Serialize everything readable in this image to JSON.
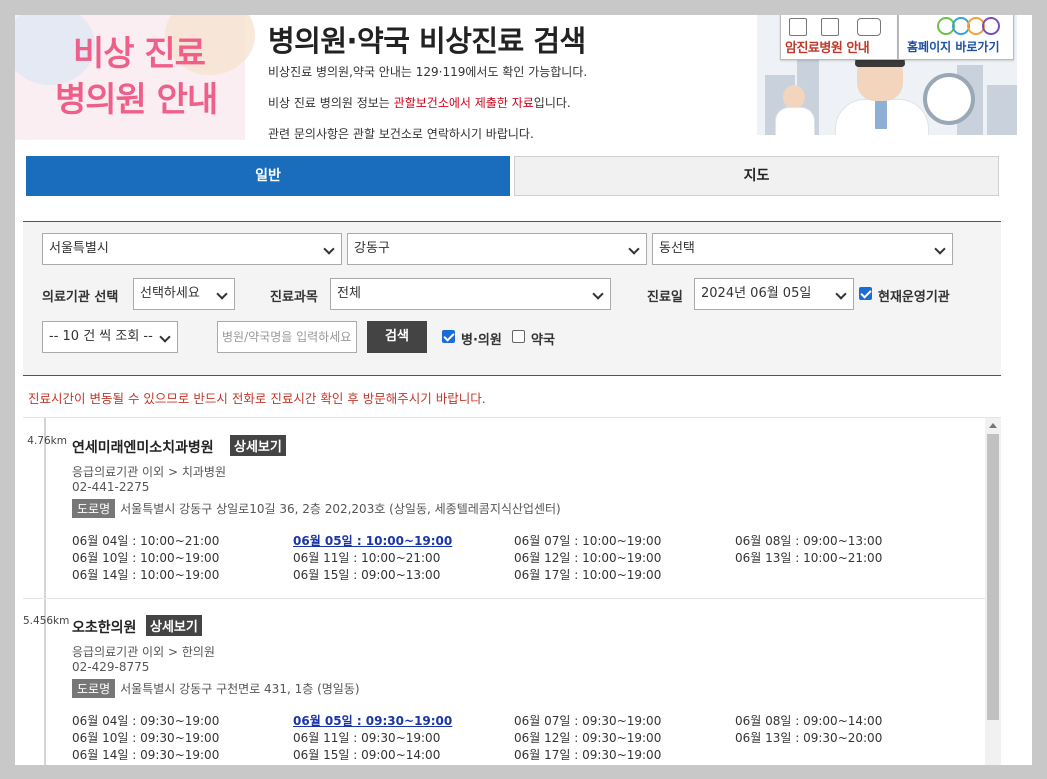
{
  "header": {
    "logo_line1": "비상 진료",
    "logo_line2": "병의원 안내",
    "title": "병의원·약국 비상진료 검색",
    "info1": "비상진료 병의원,약국 안내는 129·119에서도 확인 가능합니다.",
    "info2_prefix": "비상 진료 병의원 정보는 ",
    "info2_highlight": "관할보건소에서 제출한 자료",
    "info2_suffix": "입니다.",
    "info3": "관련 문의사항은 관할 보건소로 연락하시기 바랍니다.",
    "banner1_label": "암진료병원 안내",
    "banner2_label": "홈페이지 바로가기"
  },
  "tabs": [
    {
      "label": "일반",
      "active": true
    },
    {
      "label": "지도",
      "active": false
    }
  ],
  "filter": {
    "city": "서울특별시",
    "district": "강동구",
    "dong": "동선택",
    "institution_label": "의료기관 선택",
    "institution_value": "선택하세요",
    "department_label": "진료과목",
    "department_value": "전체",
    "date_label": "진료일",
    "date_value": "2024년 06월 05일",
    "operating_label": "현재운영기관",
    "operating_checked": true,
    "count_value": "-- 10 건 씩 조회 --",
    "search_placeholder": "병원/약국명을 입력하세요",
    "search_button": "검색",
    "hospital_label": "병·의원",
    "hospital_checked": true,
    "pharmacy_label": "약국",
    "pharmacy_checked": false
  },
  "notice": "진료시간이 변동될 수 있으므로 반드시 전화로 진료시간 확인 후 방문해주시기 바랍니다.",
  "colors": {
    "accent": "#1a6cbd",
    "notice": "#c0392b",
    "logo": "#ee5f8a"
  },
  "results": [
    {
      "distance": "4.76km",
      "name": "연세미래엔미소치과병원",
      "detail_button": "상세보기",
      "category": "응급의료기관 이외 > 치과병원",
      "phone": "02-441-2275",
      "road_label": "도로명",
      "address": "서울특별시 강동구 상일로10길 36, 2층 202,203호 (상일동, 세종텔레콤지식산업센터)",
      "hours": [
        "06월 04일 : 10:00~21:00",
        "06월 05일 : 10:00~19:00",
        "06월 07일 : 10:00~19:00",
        "06월 08일 : 09:00~13:00",
        "06월 10일 : 10:00~19:00",
        "06월 11일 : 10:00~21:00",
        "06월 12일 : 10:00~19:00",
        "06월 13일 : 10:00~21:00",
        "06월 14일 : 10:00~19:00",
        "06월 15일 : 09:00~13:00",
        "06월 17일 : 10:00~19:00"
      ],
      "today_index": 1
    },
    {
      "distance": "5.456km",
      "name": "오초한의원",
      "detail_button": "상세보기",
      "category": "응급의료기관 이외 > 한의원",
      "phone": "02-429-8775",
      "road_label": "도로명",
      "address": "서울특별시 강동구 구천면로 431, 1층 (명일동)",
      "hours": [
        "06월 04일 : 09:30~19:00",
        "06월 05일 : 09:30~19:00",
        "06월 07일 : 09:30~19:00",
        "06월 08일 : 09:00~14:00",
        "06월 10일 : 09:30~19:00",
        "06월 11일 : 09:30~19:00",
        "06월 12일 : 09:30~19:00",
        "06월 13일 : 09:30~20:00",
        "06월 14일 : 09:30~19:00",
        "06월 15일 : 09:00~14:00",
        "06월 17일 : 09:30~19:00"
      ],
      "today_index": 1
    }
  ]
}
